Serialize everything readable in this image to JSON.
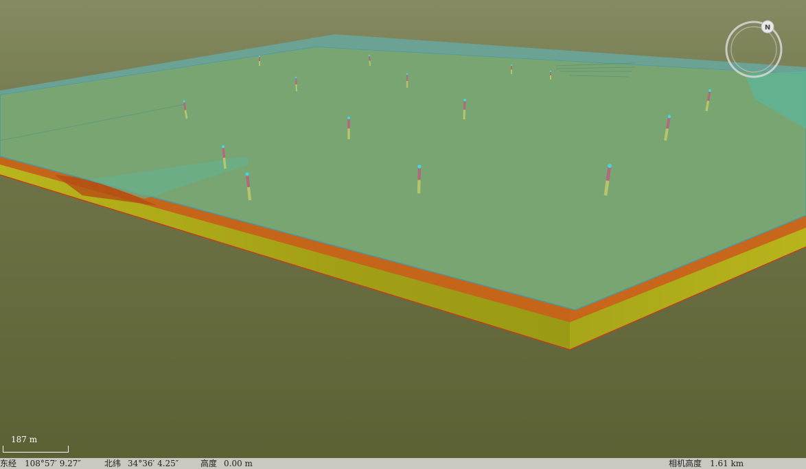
{
  "scale_bar": {
    "label": "187 m"
  },
  "compass": {
    "icon": "north-compass-icon",
    "letter": "N"
  },
  "status": {
    "longitude_label": "东经",
    "longitude_value": "108°57′ 9.27″",
    "latitude_label": "北纬",
    "latitude_value": "34°36′ 4.25″",
    "height_label": "高度",
    "height_value": "0.00 m",
    "camera_label": "相机高度",
    "camera_value": "1.61 km"
  },
  "colors": {
    "ground": "#5e6436",
    "sky": "#7a7f55",
    "surface": "#79a573",
    "surface_edge": "#4fa6a0",
    "orange_layer": "#c96a1a",
    "yellow_layer": "#a8a61a",
    "borehole_top": "#b06a7a",
    "borehole_bottom": "#b7c46a",
    "borehole_cap": "#40d8e8",
    "statusbar": "#c9c9c2"
  },
  "boreholes_count": 17
}
